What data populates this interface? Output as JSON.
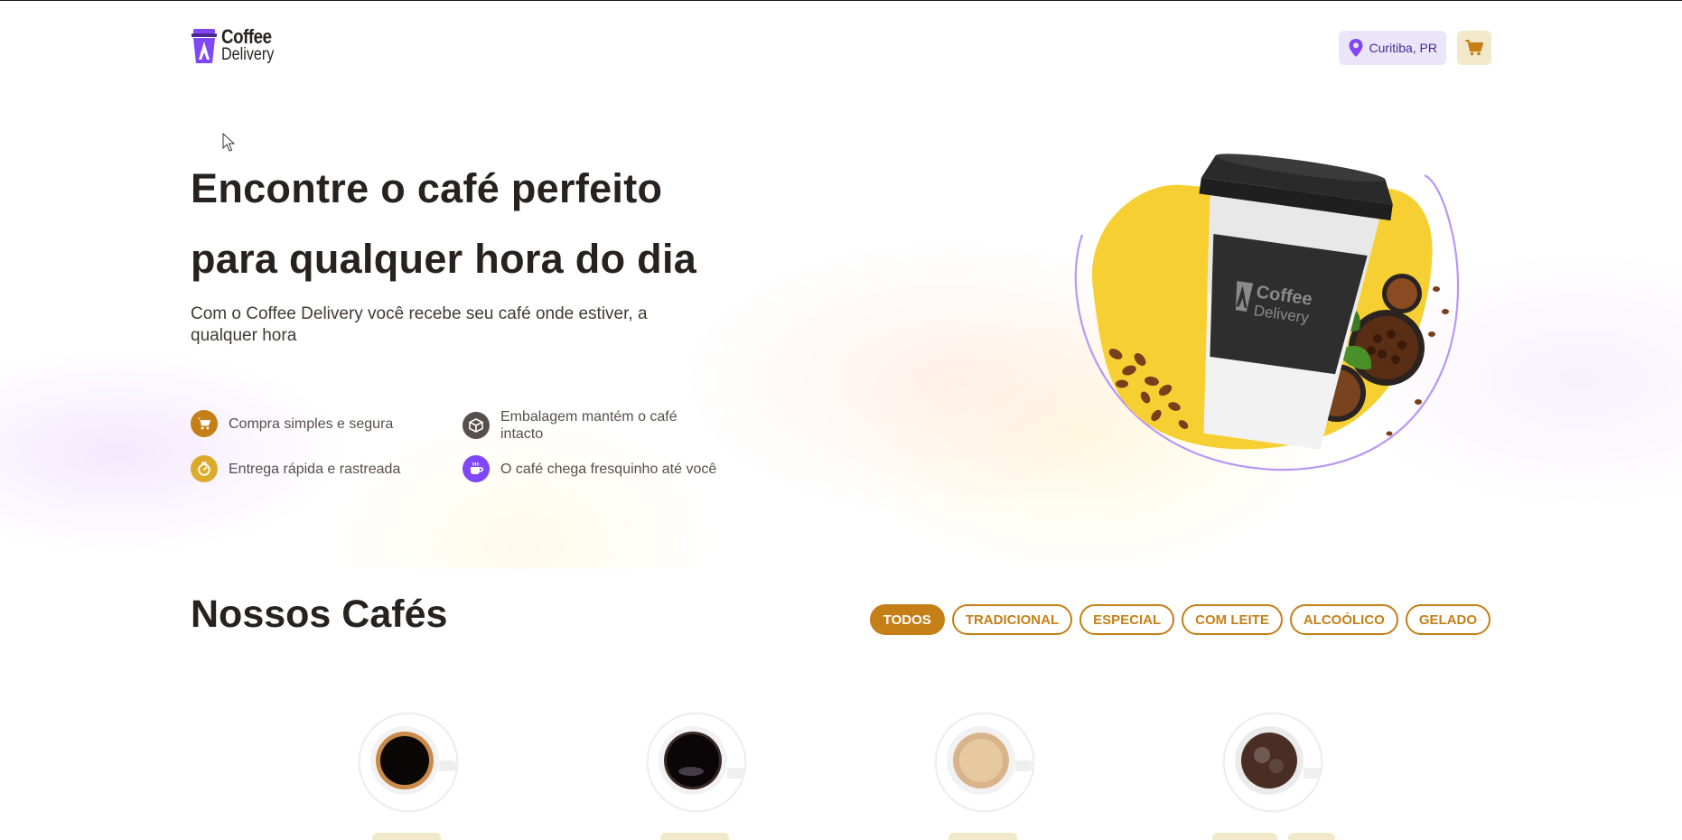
{
  "header": {
    "logo_line1": "Coffee",
    "logo_line2": "Delivery",
    "location": "Curitiba, PR",
    "icons": {
      "location": "map-pin-icon",
      "cart": "shopping-cart-icon"
    }
  },
  "hero": {
    "title_line1": "Encontre o café perfeito",
    "title_line2": "para qualquer hora do dia",
    "subtitle": "Com o Coffee Delivery você recebe seu café onde estiver, a qualquer hora",
    "features": [
      {
        "label": "Compra simples e segura",
        "icon": "shopping-cart-icon",
        "color": "#C47F17"
      },
      {
        "label": "Embalagem mantém o café intacto",
        "icon": "package-icon",
        "color": "#574F4D"
      },
      {
        "label": "Entrega rápida e rastreada",
        "icon": "timer-icon",
        "color": "#DBAC2C"
      },
      {
        "label": "O café chega fresquinho até você",
        "icon": "coffee-icon",
        "color": "#8047F8"
      }
    ],
    "art_label_line1": "Coffee",
    "art_label_line2": "Delivery"
  },
  "coffees": {
    "title": "Nossos Cafés",
    "filters": [
      {
        "label": "TODOS",
        "active": true
      },
      {
        "label": "TRADICIONAL",
        "active": false
      },
      {
        "label": "ESPECIAL",
        "active": false
      },
      {
        "label": "COM LEITE",
        "active": false
      },
      {
        "label": "ALCOÓLICO",
        "active": false
      },
      {
        "label": "GELADO",
        "active": false
      }
    ]
  },
  "colors": {
    "yellow_dark": "#C47F17",
    "yellow": "#DBAC2C",
    "yellow_light": "#F1E9C9",
    "purple_dark": "#4B2995",
    "purple": "#8047F8",
    "purple_light": "#EBE5F9",
    "base_title": "#272221"
  }
}
